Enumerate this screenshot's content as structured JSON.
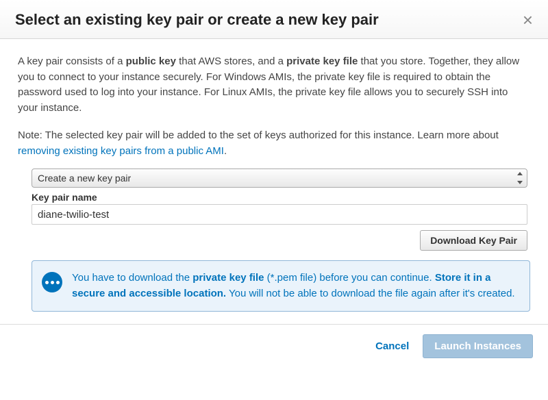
{
  "header": {
    "title": "Select an existing key pair or create a new key pair"
  },
  "description": {
    "pre1": "A key pair consists of a ",
    "bold1": "public key",
    "mid1": " that AWS stores, and a ",
    "bold2": "private key file",
    "post1": " that you store. Together, they allow you to connect to your instance securely. For Windows AMIs, the private key file is required to obtain the password used to log into your instance. For Linux AMIs, the private key file allows you to securely SSH into your instance."
  },
  "note": {
    "text": "Note: The selected key pair will be added to the set of keys authorized for this instance. Learn more about ",
    "link": "removing existing key pairs from a public AMI",
    "period": "."
  },
  "form": {
    "select_value": "Create a new key pair",
    "keypair_label": "Key pair name",
    "keypair_value": "diane-twilio-test",
    "download_button": "Download Key Pair"
  },
  "alert": {
    "p1a": "You have to download the ",
    "p1b": "private key file",
    "p1c": " (*.pem file) before you can continue. ",
    "p2a": "Store it in a secure and accessible location.",
    "p2b": " You will not be able to download the file again after it's created."
  },
  "footer": {
    "cancel": "Cancel",
    "launch": "Launch Instances"
  }
}
